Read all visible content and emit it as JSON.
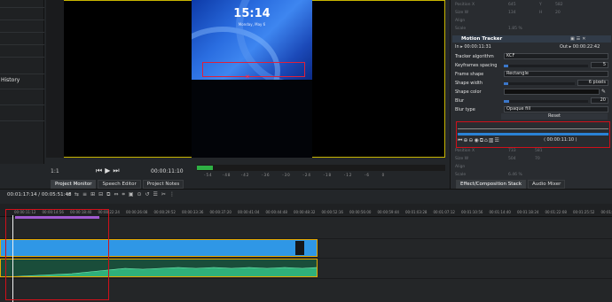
{
  "left_panel": {
    "history_label": "History"
  },
  "monitor": {
    "phone_time": "15:14",
    "phone_date": "Monday, May 6",
    "zoom": "1:1",
    "timecode": "00:00:11:10",
    "db_ticks": [
      "-54",
      "-48",
      "-42",
      "-36",
      "-30",
      "-24",
      "-18",
      "-12",
      "-6",
      "0"
    ],
    "tabs": [
      "Project Monitor",
      "Speech Editor",
      "Project Notes"
    ]
  },
  "effect_panel": {
    "faint_labels": [
      {
        "label": "Position X",
        "v1": "645",
        "k2": "Y",
        "v2": "582"
      },
      {
        "label": "Size W",
        "v1": "134",
        "k2": "H",
        "v2": "20"
      },
      {
        "label": "Align",
        "v1": "",
        "k2": "",
        "v2": ""
      },
      {
        "label": "Scale",
        "v1": "1.85 %",
        "k2": "",
        "v2": ""
      }
    ],
    "title": "Motion Tracker",
    "in_label": "In",
    "in_tc": "00:00:11:31",
    "out_label": "Out",
    "out_tc": "00:00:22:42",
    "params": {
      "algorithm_label": "Tracker algorithm",
      "algorithm_value": "KCF",
      "kf_spacing_label": "Keyframes spacing",
      "kf_spacing_value": "5",
      "frame_shape_label": "Frame shape",
      "frame_shape_value": "Rectangle",
      "shape_width_label": "Shape width",
      "shape_width_value": "6 pixels",
      "shape_color_label": "Shape color",
      "blur_label": "Blur",
      "blur_value": "20",
      "blur_type_label": "Blur type",
      "blur_type_value": "Opaque fill"
    },
    "reset_label": "Reset",
    "kf_timecode": "00:00:11:10",
    "faint_bottom": [
      {
        "label": "Position X",
        "v1": "733",
        "v2": "581"
      },
      {
        "label": "Size W",
        "v1": "504",
        "v2": "70"
      },
      {
        "label": "Align",
        "v1": "",
        "v2": ""
      },
      {
        "label": "Scale",
        "v1": "6.46 %",
        "v2": ""
      }
    ],
    "tabs": [
      "Effect/Composition Stack",
      "Audio Mixer"
    ]
  },
  "timeline": {
    "position_tc": "00:01:17:14",
    "duration_tc": "00:05:51:48",
    "ruler_ticks": [
      "00:00:11:12",
      "00:00:14:56",
      "00:00:18:40",
      "00:00:22:24",
      "00:00:26:08",
      "00:00:29:52",
      "00:00:33:36",
      "00:00:37:20",
      "00:00:41:04",
      "00:00:44:48",
      "00:00:48:32",
      "00:00:52:16",
      "00:00:56:00",
      "00:00:59:44",
      "00:01:03:28",
      "00:01:07:12",
      "00:01:10:56",
      "00:01:14:40",
      "00:01:18:24",
      "00:01:22:08",
      "00:01:25:52",
      "00:01:29:36"
    ]
  },
  "colors": {
    "accent": "#2f97e6",
    "highlight_red": "#d0101a",
    "audio_green": "#2fb07a",
    "zone": "#a05ad0"
  }
}
